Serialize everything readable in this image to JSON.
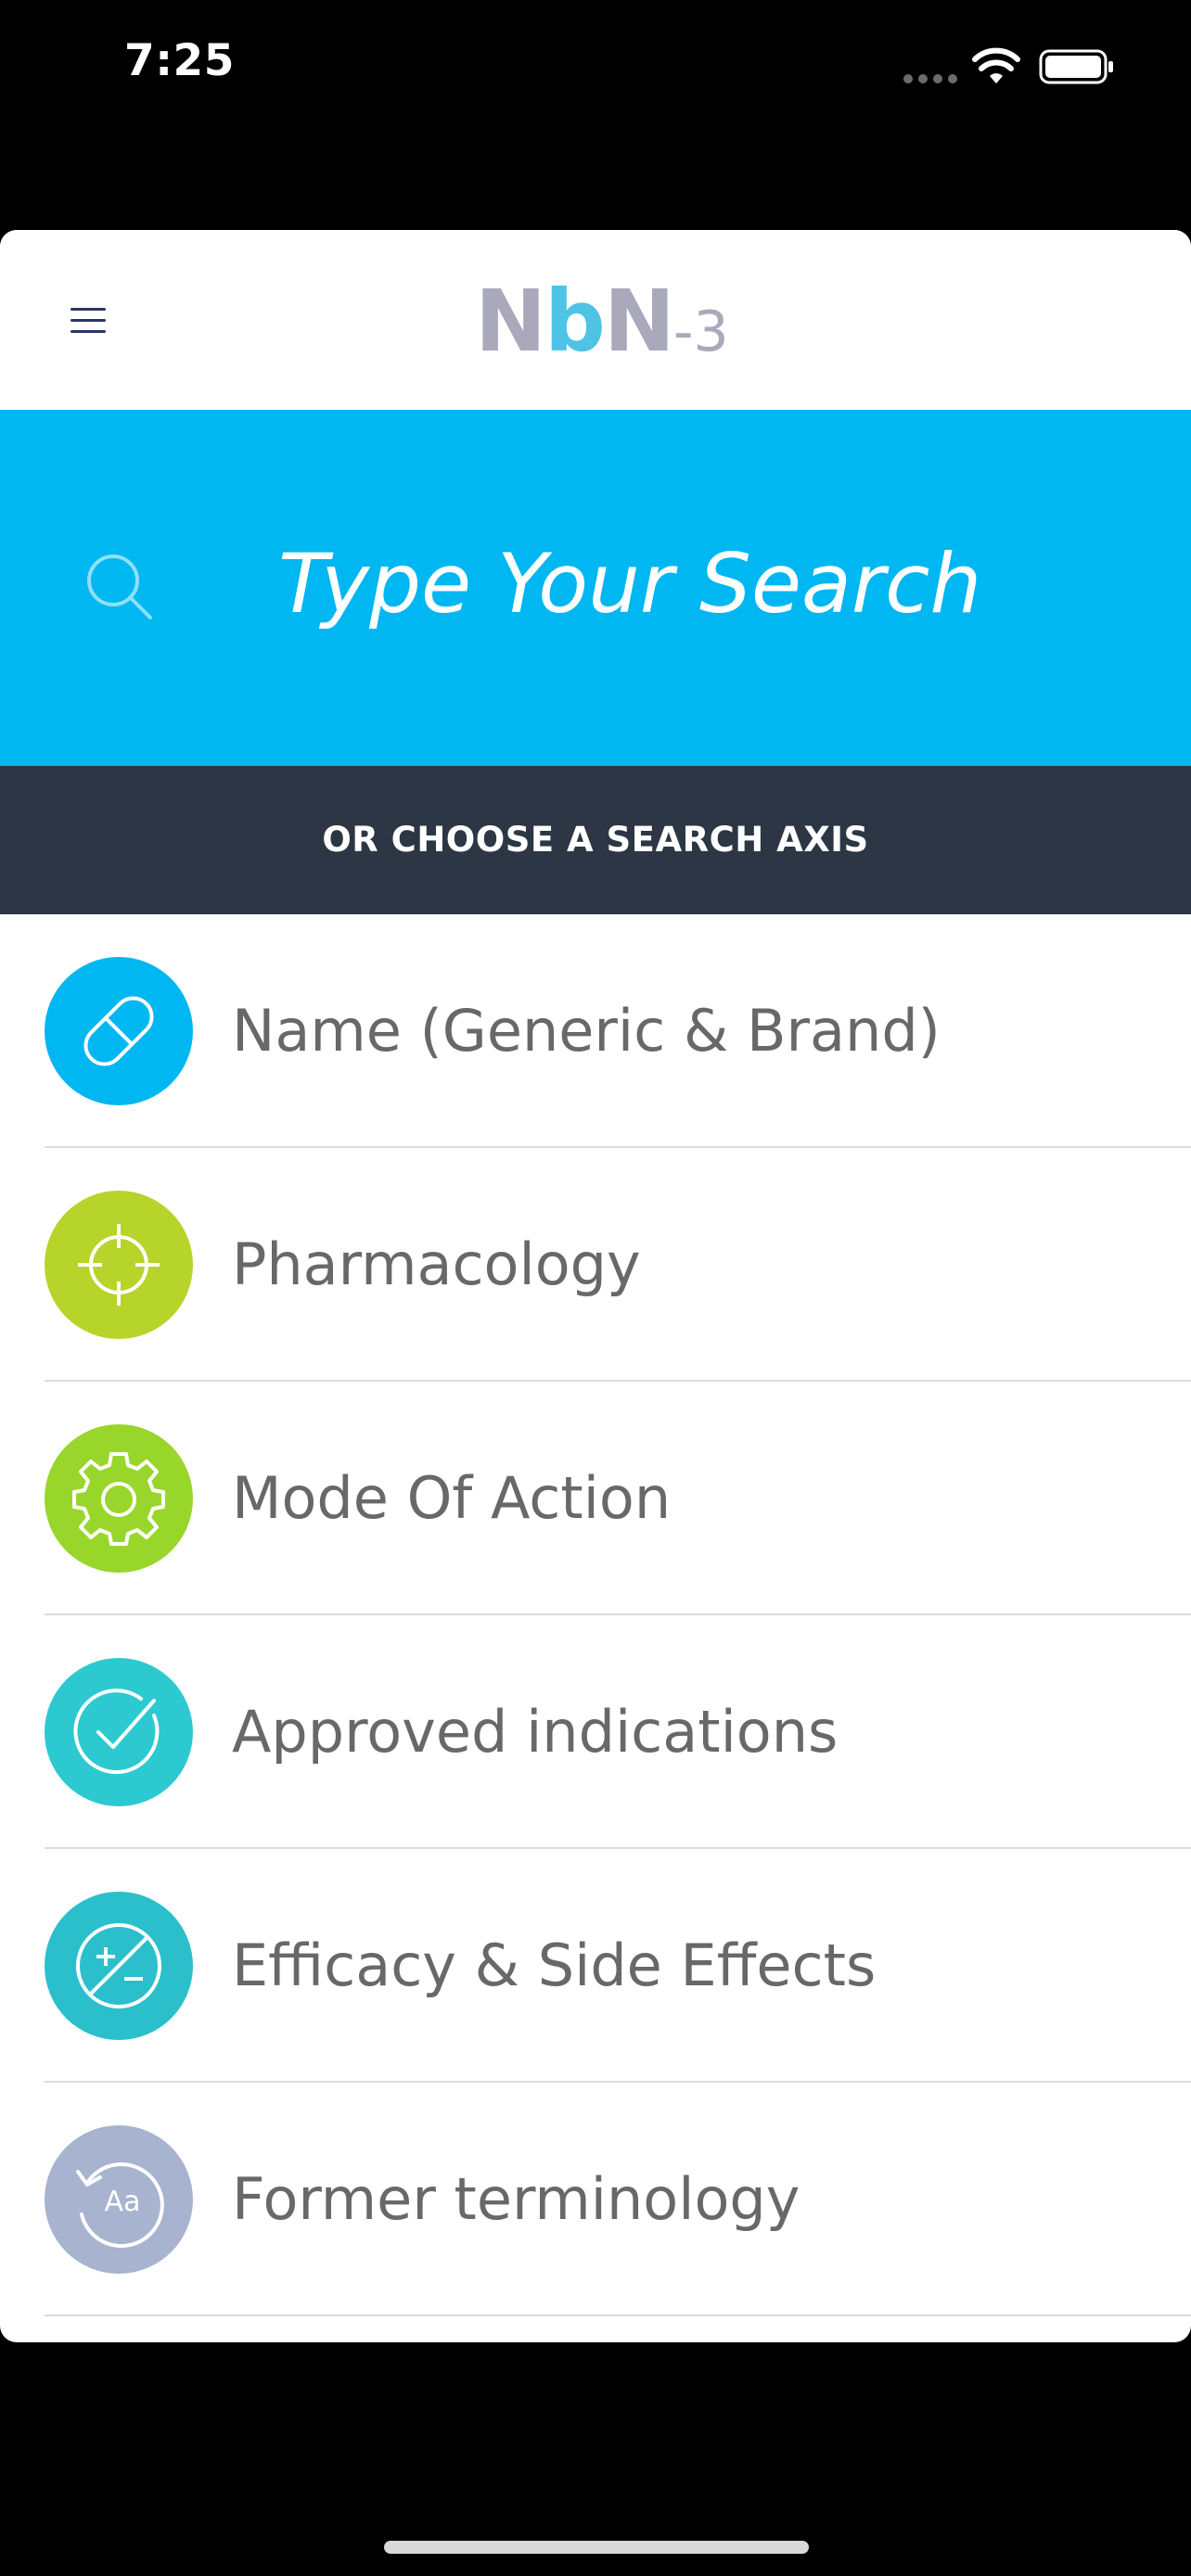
{
  "status_bar": {
    "time": "7:25",
    "signal_icon": "cellular-signal-icon",
    "wifi_icon": "wifi-icon",
    "battery_icon": "battery-full-icon"
  },
  "nav": {
    "menu_icon": "hamburger-menu-icon",
    "logo": {
      "part1": "N",
      "part2": "b",
      "part3": "N",
      "suffix": "-3"
    }
  },
  "search": {
    "icon": "search-icon",
    "placeholder": "Type Your Search",
    "value": ""
  },
  "axis_header": "OR CHOOSE A SEARCH AXIS",
  "axes": [
    {
      "label": "Name (Generic & Brand)",
      "icon": "pill-icon",
      "color": "#00b7f1"
    },
    {
      "label": "Pharmacology",
      "icon": "crosshair-icon",
      "color": "#b7d42a"
    },
    {
      "label": "Mode Of Action",
      "icon": "gear-icon",
      "color": "#98d62b"
    },
    {
      "label": "Approved indications",
      "icon": "checkmark-circle-icon",
      "color": "#2ccad0"
    },
    {
      "label": "Efficacy & Side Effects",
      "icon": "plus-minus-icon",
      "color": "#2bbfcc"
    },
    {
      "label": "Former terminology",
      "icon": "history-text-icon",
      "color": "#a8b3cf"
    }
  ],
  "colors": {
    "search_bar": "#00b7f1",
    "axis_header_bg": "#2c3644",
    "label_text": "#686868",
    "logo_gray": "#a9a9bb",
    "logo_blue": "#4ec3e6"
  }
}
